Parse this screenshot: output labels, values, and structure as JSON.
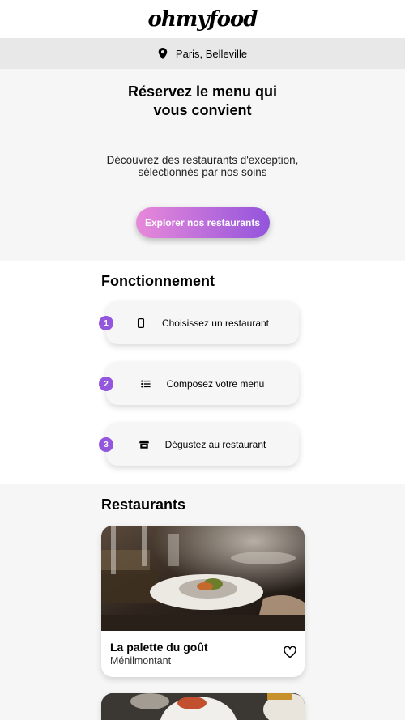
{
  "header": {
    "logo": "ohmyfood"
  },
  "location": {
    "label": "Paris, Belleville",
    "icon": "location-pin-icon"
  },
  "hero": {
    "title": "Réservez le menu qui vous convient",
    "subtitle": "Découvrez des restaurants d'exception, sélectionnés par nos soins",
    "cta_label": "Explorer nos restaurants"
  },
  "how_it_works": {
    "title": "Fonctionnement",
    "steps": [
      {
        "number": "1",
        "label": "Choisissez un restaurant",
        "icon": "mobile-phone-icon"
      },
      {
        "number": "2",
        "label": "Composez votre menu",
        "icon": "list-icon"
      },
      {
        "number": "3",
        "label": "Dégustez au restaurant",
        "icon": "store-icon"
      }
    ]
  },
  "restaurants": {
    "title": "Restaurants",
    "items": [
      {
        "name": "La palette du goût",
        "area": "Ménilmontant",
        "favorite_icon": "heart-outline-icon"
      }
    ]
  },
  "colors": {
    "accent_start": "#e889d9",
    "accent_end": "#9354dc",
    "step_badge": "#9356dc",
    "band_gray": "#e8e8e8",
    "section_gray": "#f6f6f6"
  }
}
